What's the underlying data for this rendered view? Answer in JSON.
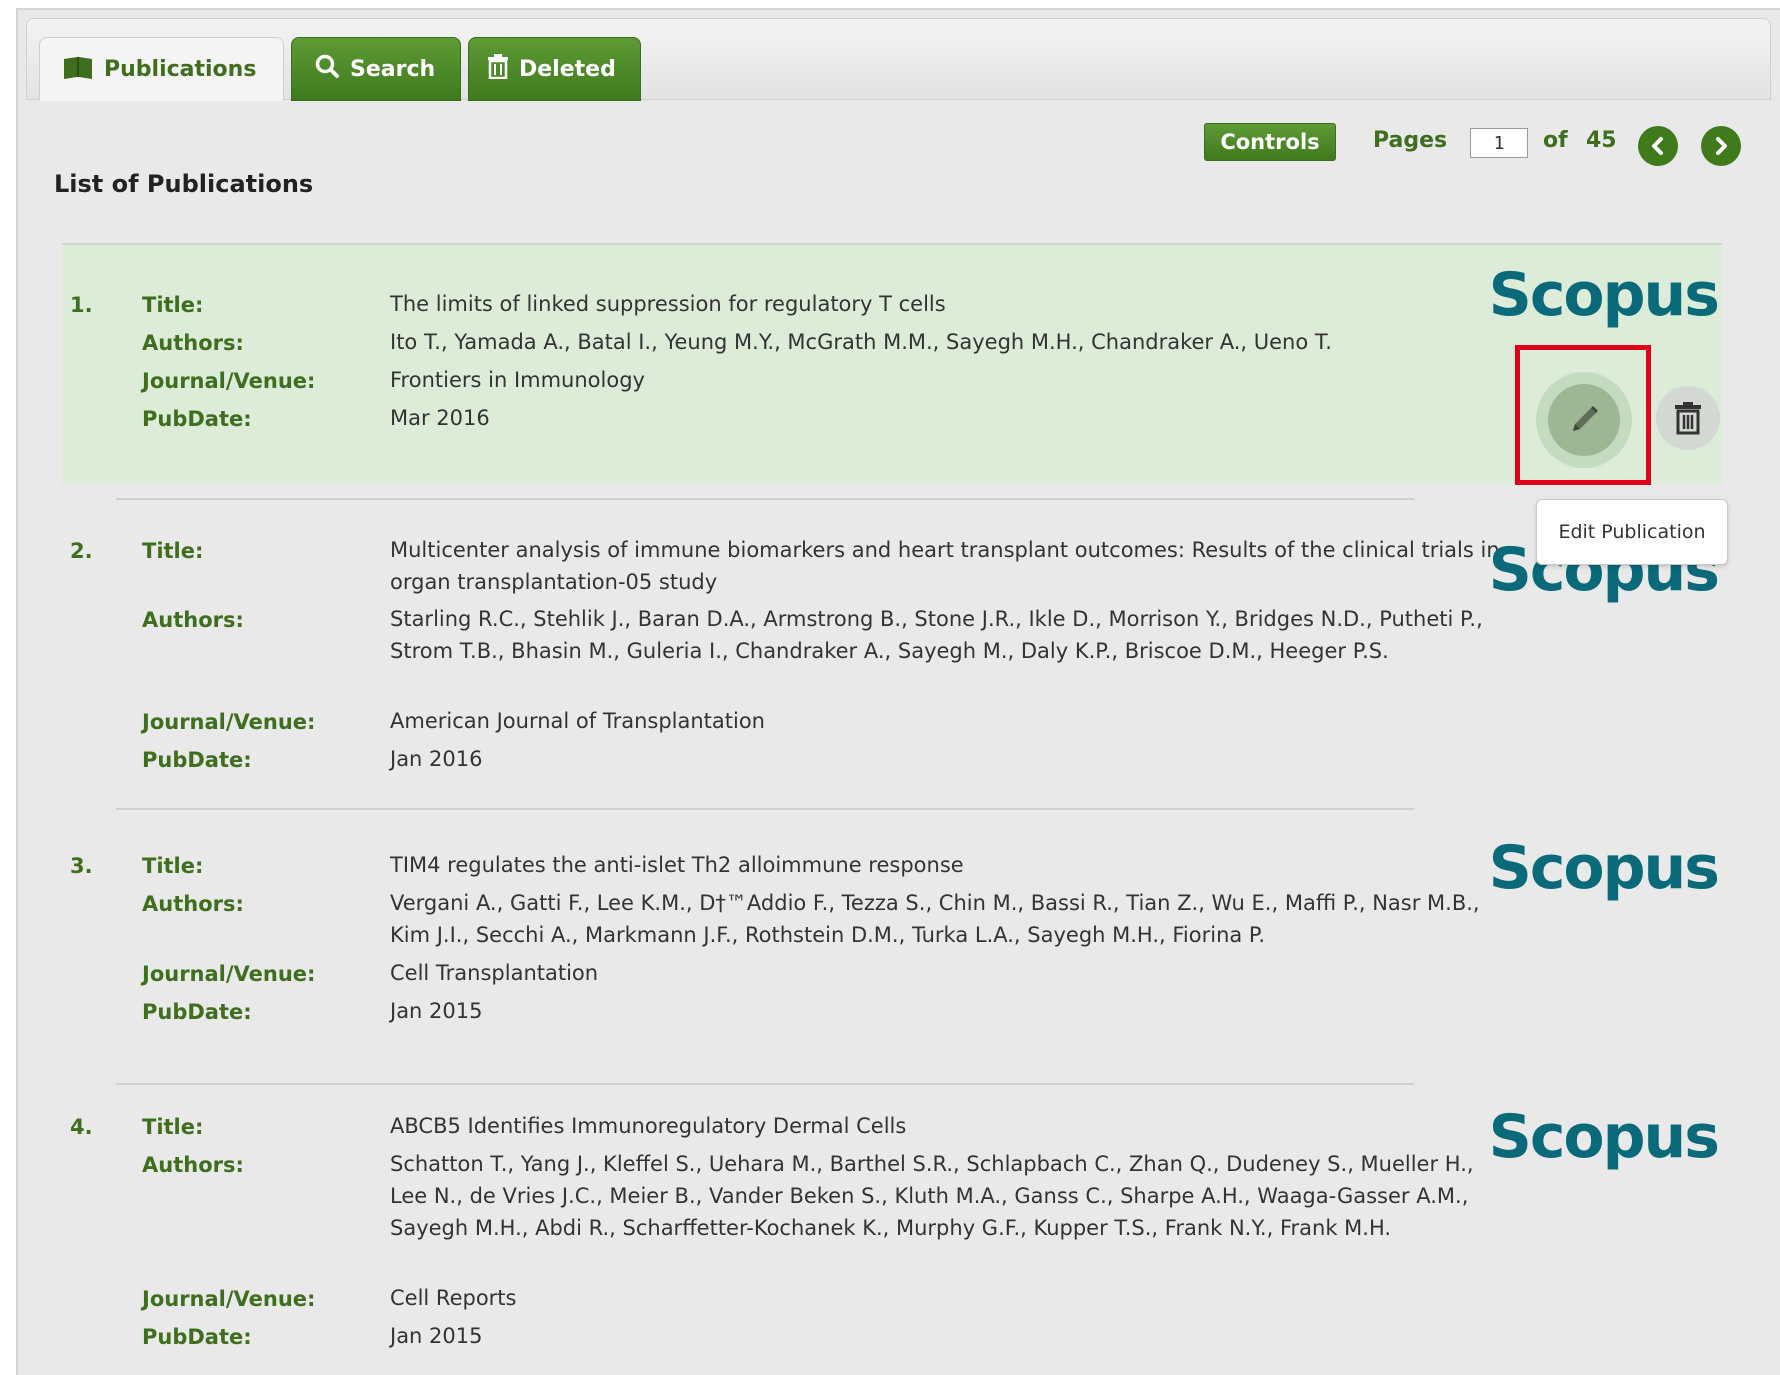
{
  "tabs": [
    {
      "label": "Publications",
      "icon": "book-icon"
    },
    {
      "label": "Search",
      "icon": "search-icon"
    },
    {
      "label": "Deleted",
      "icon": "trash-icon"
    }
  ],
  "toolbar": {
    "controls_label": "Controls",
    "pages_label": "Pages",
    "current_page": "1",
    "of_label": "of",
    "total_pages": "45"
  },
  "list_title": "List of Publications",
  "labels": {
    "title": "Title:",
    "authors": "Authors:",
    "journal": "Journal/Venue:",
    "pubdate": "PubDate:"
  },
  "scopus_label": "Scopus",
  "tooltip": "Edit Publication",
  "colors": {
    "accent": "#3f7a1d",
    "highlight_row": "#dcecd8",
    "scopus": "#0a6a7a",
    "annotation_box": "#e0001a"
  },
  "publications": [
    {
      "num": "1.",
      "title": "The limits of linked suppression for regulatory T cells",
      "authors": "Ito T., Yamada A., Batal I., Yeung M.Y., McGrath M.M., Sayegh M.H., Chandraker A., Ueno T.",
      "journal": "Frontiers in Immunology",
      "pubdate": "Mar 2016"
    },
    {
      "num": "2.",
      "title": "Multicenter analysis of immune biomarkers and heart transplant outcomes: Results of the clinical trials in organ transplantation-05 study",
      "authors": "Starling R.C., Stehlik J., Baran D.A., Armstrong B., Stone J.R., Ikle D., Morrison Y., Bridges N.D., Putheti P., Strom T.B., Bhasin M., Guleria I., Chandraker A., Sayegh M., Daly K.P., Briscoe D.M., Heeger P.S.",
      "journal": "American Journal of Transplantation",
      "pubdate": "Jan 2016"
    },
    {
      "num": "3.",
      "title": "TIM4 regulates the anti-islet Th2 alloimmune response",
      "authors": "Vergani A., Gatti F., Lee K.M., D†™Addio F., Tezza S., Chin M., Bassi R., Tian Z., Wu E., Maffi P., Nasr M.B., Kim J.I., Secchi A., Markmann J.F., Rothstein D.M., Turka L.A., Sayegh M.H., Fiorina P.",
      "journal": "Cell Transplantation",
      "pubdate": "Jan 2015"
    },
    {
      "num": "4.",
      "title": "ABCB5 Identifies Immunoregulatory Dermal Cells",
      "authors": "Schatton T., Yang J., Kleffel S., Uehara M., Barthel S.R., Schlapbach C., Zhan Q., Dudeney S., Mueller H., Lee N., de Vries J.C., Meier B., Vander Beken S., Kluth M.A., Ganss C., Sharpe A.H., Waaga-Gasser A.M., Sayegh M.H., Abdi R., Scharffetter-Kochanek K., Murphy G.F., Kupper T.S., Frank N.Y., Frank M.H.",
      "journal": "Cell Reports",
      "pubdate": "Jan 2015"
    }
  ]
}
